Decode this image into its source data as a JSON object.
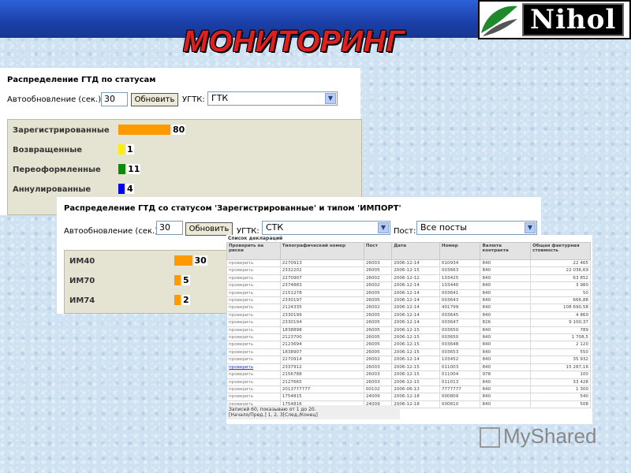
{
  "header": {
    "title": "МОНИТОРИНГ",
    "logo_text": "Nihol"
  },
  "panel1": {
    "title": "Распределение ГТД по статусам",
    "refresh_label": "Автообновление (сек.):",
    "refresh_value": "30",
    "refresh_button": "Обновить",
    "customs_label": "УГТК:",
    "customs_value": "ГТК",
    "rows": [
      {
        "label": "Зарегистрированные",
        "value": "80",
        "count": 80,
        "color": "#ff9900"
      },
      {
        "label": "Возвращенные",
        "value": "1",
        "count": 1,
        "color": "#ffee00"
      },
      {
        "label": "Переоформленные",
        "value": "11",
        "count": 11,
        "color": "#118811"
      },
      {
        "label": "Аннулированные",
        "value": "4",
        "count": 4,
        "color": "#0000ee"
      }
    ]
  },
  "panel2": {
    "title": "Распределение ГТД со статусом 'Зарегистрированные' и типом 'ИМПОРТ'",
    "refresh_label": "Автообновление (сек.):",
    "refresh_value": "30",
    "refresh_button": "Обновить",
    "customs_label": "УГТК:",
    "customs_value": "СТК",
    "post_label": "Пост:",
    "post_value": "Все посты",
    "rows": [
      {
        "label": "ИМ40",
        "value": "30",
        "count": 30,
        "color": "#ff9900"
      },
      {
        "label": "ИМ70",
        "value": "5",
        "count": 5,
        "color": "#ff9900"
      },
      {
        "label": "ИМ74",
        "value": "2",
        "count": 2,
        "color": "#ff9900"
      }
    ]
  },
  "table": {
    "caption": "Список деклараций",
    "headers": [
      "Проверить на риски",
      "Типографический номер",
      "Пост",
      "Дата",
      "Номер",
      "Валюта контракта",
      "Общая фактурная стоимость"
    ],
    "rows": [
      [
        "проверить",
        "2270913",
        "26003",
        "2006-12-14",
        "010934",
        "840",
        "22 465"
      ],
      [
        "проверить",
        "2332202",
        "26005",
        "2006-12-15",
        "003663",
        "840",
        "22 036,69"
      ],
      [
        "проверить",
        "2270907",
        "26002",
        "2006-12-12",
        "103425",
        "840",
        "63 852"
      ],
      [
        "проверить",
        "2374883",
        "26002",
        "2006-12-14",
        "103440",
        "840",
        "3 980"
      ],
      [
        "проверить",
        "2151278",
        "26005",
        "2006-12-14",
        "003641",
        "840",
        "50"
      ],
      [
        "проверить",
        "2330197",
        "26005",
        "2006-12-14",
        "003643",
        "840",
        "666,88"
      ],
      [
        "проверить",
        "2124335",
        "26002",
        "2006-12-14",
        "401799",
        "840",
        "108 690,58"
      ],
      [
        "проверить",
        "2330199",
        "26005",
        "2006-12-14",
        "003645",
        "840",
        "4 860"
      ],
      [
        "проверить",
        "2330194",
        "26005",
        "2006-12-14",
        "003647",
        "826",
        "9 100,37"
      ],
      [
        "проверить",
        "1838898",
        "26005",
        "2006-12-15",
        "003650",
        "840",
        "789"
      ],
      [
        "проверить",
        "2123700",
        "26005",
        "2006-12-15",
        "003650",
        "840",
        "1 708,5"
      ],
      [
        "проверить",
        "2123694",
        "26005",
        "2006-12-15",
        "003648",
        "840",
        "2 120"
      ],
      [
        "проверить",
        "1838907",
        "26005",
        "2006-12-15",
        "003653",
        "840",
        "550"
      ],
      [
        "проверить",
        "2270914",
        "26002",
        "2006-12-14",
        "103452",
        "840",
        "35 932"
      ],
      [
        "проверить",
        "2337912",
        "26003",
        "2006-12-15",
        "011003",
        "840",
        "15 287,16"
      ],
      [
        "проверить",
        "2156788",
        "26003",
        "2006-12-15",
        "011004",
        "978",
        "100"
      ],
      [
        "проверить",
        "2127665",
        "26003",
        "2006-12-15",
        "011013",
        "840",
        "33 428"
      ],
      [
        "проверить",
        "2013777777",
        "00102",
        "2006-06-13",
        "7777777",
        "840",
        "1 300"
      ],
      [
        "проверить",
        "1754815",
        "24009",
        "2006-12-18",
        "000809",
        "840",
        "540"
      ],
      [
        "проверить",
        "1754816",
        "24009",
        "2006-12-18",
        "000810",
        "840",
        "508"
      ]
    ],
    "active_row": 14,
    "footer_line1": "Записей 60, показываю от 1 до 20.",
    "footer_line2": "[Начало/Пред.] 1, 2, 3[След./Конец]"
  },
  "watermark": {
    "text": "MyShared"
  }
}
